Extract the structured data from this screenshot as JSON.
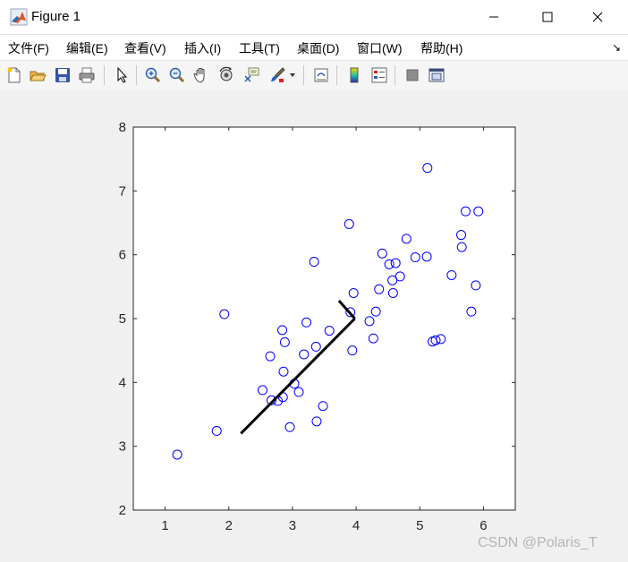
{
  "window": {
    "title": "Figure 1",
    "controls": [
      "minimize-icon",
      "maximize-icon",
      "close-icon"
    ]
  },
  "menu": {
    "items": [
      {
        "label": "文件(F)"
      },
      {
        "label": "编辑(E)"
      },
      {
        "label": "查看(V)"
      },
      {
        "label": "插入(I)"
      },
      {
        "label": "工具(T)"
      },
      {
        "label": "桌面(D)"
      },
      {
        "label": "窗口(W)"
      },
      {
        "label": "帮助(H)"
      }
    ],
    "dock_arrow": "↘"
  },
  "toolbar": {
    "icons": [
      "new-figure-icon",
      "open-file-icon",
      "save-icon",
      "print-icon",
      "pointer-icon",
      "zoom-in-icon",
      "zoom-out-icon",
      "pan-hand-icon",
      "rotate-3d-icon",
      "data-cursor-icon",
      "brush-icon",
      "brush-dropdown-icon",
      "link-plot-icon",
      "colorbar-icon",
      "legend-icon",
      "hide-plot-tools-icon",
      "show-plot-tools-icon"
    ]
  },
  "chart_data": {
    "type": "scatter",
    "title": "",
    "xlabel": "",
    "ylabel": "",
    "xlim": [
      0.5,
      6.5
    ],
    "ylim": [
      2,
      8
    ],
    "xticks": [
      1,
      2,
      3,
      4,
      5,
      6
    ],
    "yticks": [
      2,
      3,
      4,
      5,
      6,
      7,
      8
    ],
    "grid": false,
    "marker": "circle",
    "marker_color": "#0000ff",
    "series": [
      {
        "x": [
          1.19,
          1.81,
          1.93,
          2.53,
          2.65,
          2.67,
          2.77,
          2.84,
          2.85,
          2.86,
          2.88,
          2.96,
          3.03,
          3.1,
          3.18,
          3.22,
          3.34,
          3.37,
          3.38,
          3.48,
          3.58,
          3.89,
          3.91,
          3.94,
          3.96,
          4.21,
          4.27,
          4.31,
          4.36,
          4.41,
          4.52,
          4.57,
          4.58,
          4.62,
          4.69,
          4.79,
          4.93,
          5.11,
          5.12,
          5.2,
          5.25,
          5.33,
          5.5,
          5.65,
          5.66,
          5.72,
          5.81,
          5.88,
          5.92
        ],
        "y": [
          2.87,
          3.24,
          5.07,
          3.88,
          4.41,
          3.72,
          3.71,
          4.82,
          3.77,
          4.17,
          4.63,
          3.3,
          3.98,
          3.85,
          4.44,
          4.94,
          5.89,
          4.56,
          3.39,
          3.63,
          4.81,
          6.48,
          5.1,
          4.5,
          5.4,
          4.96,
          4.69,
          5.11,
          5.46,
          6.02,
          5.85,
          5.6,
          5.4,
          5.87,
          5.66,
          6.25,
          5.96,
          5.97,
          7.36,
          4.64,
          4.66,
          4.68,
          5.68,
          6.31,
          6.12,
          6.68,
          5.11,
          5.52,
          6.68
        ]
      }
    ],
    "lines": [
      {
        "color": "#000000",
        "points": [
          [
            2.19,
            3.2
          ],
          [
            3.98,
            5.0
          ]
        ]
      },
      {
        "color": "#000000",
        "points": [
          [
            3.98,
            5.0
          ],
          [
            3.73,
            5.28
          ]
        ]
      }
    ]
  },
  "watermark": "CSDN @Polaris_T"
}
